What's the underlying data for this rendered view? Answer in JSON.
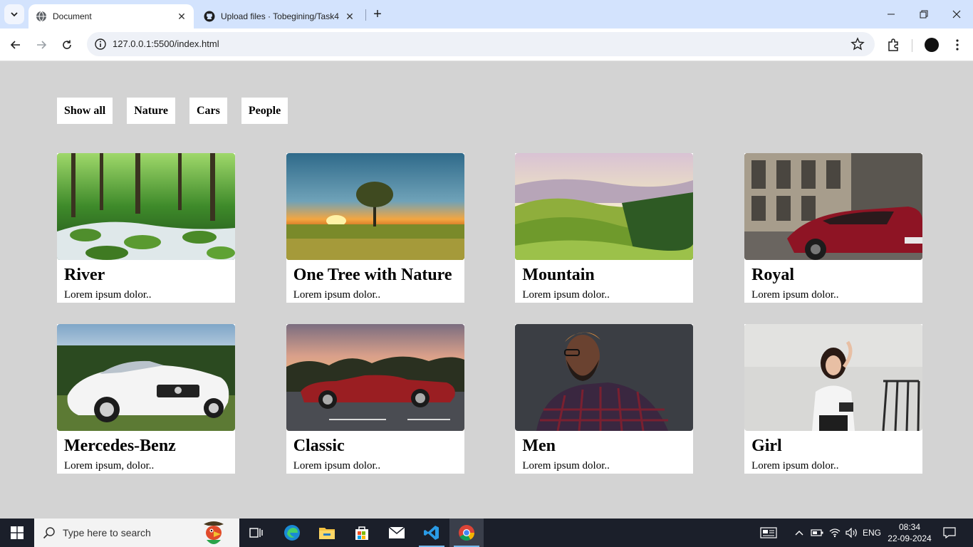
{
  "browser": {
    "tabs": [
      {
        "title": "Document",
        "active": true
      },
      {
        "title": "Upload files · Tobegining/Task4",
        "active": false
      }
    ],
    "url": "127.0.0.1:5500/index.html"
  },
  "filters": [
    "Show all",
    "Nature",
    "Cars",
    "People"
  ],
  "cards": [
    {
      "title": "River",
      "desc": "Lorem ipsum dolor..",
      "image": "forest-river"
    },
    {
      "title": "One Tree with Nature",
      "desc": "Lorem ipsum dolor..",
      "image": "sunset-tree"
    },
    {
      "title": "Mountain",
      "desc": "Lorem ipsum dolor..",
      "image": "green-hills"
    },
    {
      "title": "Royal",
      "desc": "Lorem ipsum dolor..",
      "image": "red-sports-car"
    },
    {
      "title": "Mercedes-Benz",
      "desc": "Lorem ipsum, dolor..",
      "image": "white-convertible"
    },
    {
      "title": "Classic",
      "desc": "Lorem ipsum dolor..",
      "image": "red-classic-car"
    },
    {
      "title": "Men",
      "desc": "Lorem ipsum dolor..",
      "image": "bearded-man"
    },
    {
      "title": "Girl",
      "desc": "Lorem ipsum dolor..",
      "image": "smiling-woman"
    }
  ],
  "taskbar": {
    "search_placeholder": "Type here to search",
    "language": "ENG",
    "time": "08:34",
    "date": "22-09-2024"
  }
}
